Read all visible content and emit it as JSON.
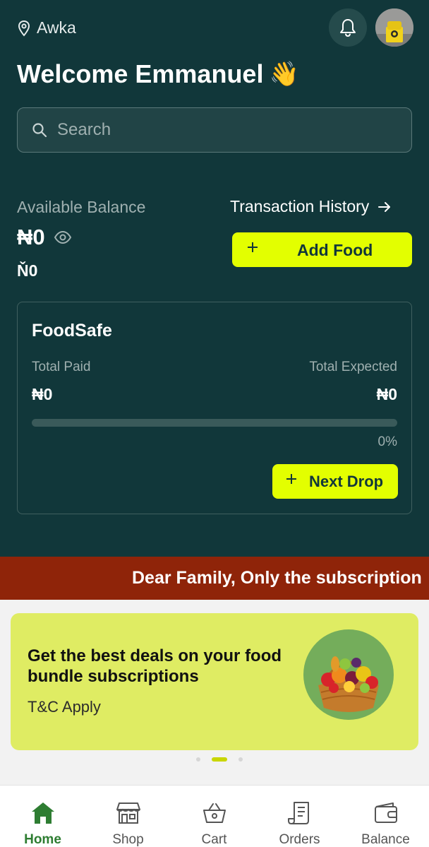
{
  "location": "Awka",
  "welcome": "Welcome Emmanuel",
  "wave": "👋",
  "search": {
    "placeholder": "Search"
  },
  "balance": {
    "label": "Available Balance",
    "amount": "₦0",
    "secondary": "Ň0",
    "history_label": "Transaction History",
    "add_food_label": "Add Food"
  },
  "foodsafe": {
    "title": "FoodSafe",
    "total_paid_label": "Total Paid",
    "total_paid_value": "₦0",
    "total_expected_label": "Total Expected",
    "total_expected_value": "₦0",
    "progress_percent": 0,
    "progress_text": "0%",
    "next_drop_label": "Next Drop"
  },
  "ticker": "Dear Family, Only the subscription",
  "banner": {
    "headline": "Get the best deals on your food bundle subscriptions",
    "subtext": "T&C Apply",
    "slides": 3,
    "active_slide": 1
  },
  "nav": [
    {
      "label": "Home",
      "icon": "home-icon",
      "active": true
    },
    {
      "label": "Shop",
      "icon": "shop-icon",
      "active": false
    },
    {
      "label": "Cart",
      "icon": "cart-icon",
      "active": false
    },
    {
      "label": "Orders",
      "icon": "orders-icon",
      "active": false
    },
    {
      "label": "Balance",
      "icon": "wallet-icon",
      "active": false
    }
  ],
  "colors": {
    "header_bg": "#11373a",
    "accent": "#e3ff00",
    "ticker_bg": "#8f2409",
    "banner_bg": "#dfec63",
    "nav_active": "#2e7d32"
  }
}
